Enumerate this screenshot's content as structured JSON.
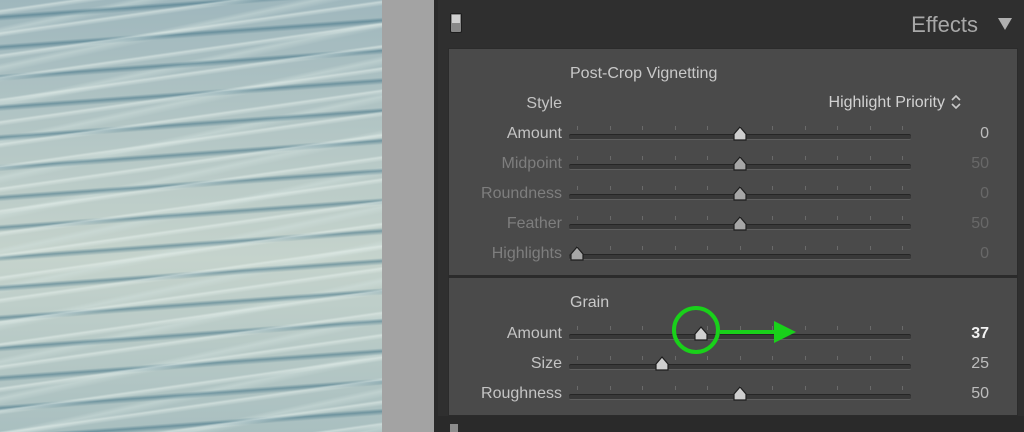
{
  "panel": {
    "title": "Effects"
  },
  "vignetting": {
    "title": "Post-Crop Vignetting",
    "style_label": "Style",
    "style_value": "Highlight Priority",
    "sliders": [
      {
        "label": "Amount",
        "value": "0",
        "position": 0.5,
        "enabled": true
      },
      {
        "label": "Midpoint",
        "value": "50",
        "position": 0.5,
        "enabled": false
      },
      {
        "label": "Roundness",
        "value": "0",
        "position": 0.5,
        "enabled": false
      },
      {
        "label": "Feather",
        "value": "50",
        "position": 0.5,
        "enabled": false
      },
      {
        "label": "Highlights",
        "value": "0",
        "position": 0.0,
        "enabled": false
      }
    ]
  },
  "grain": {
    "title": "Grain",
    "sliders": [
      {
        "label": "Amount",
        "value": "37",
        "position": 0.38,
        "enabled": true,
        "highlight": true
      },
      {
        "label": "Size",
        "value": "25",
        "position": 0.26,
        "enabled": true
      },
      {
        "label": "Roughness",
        "value": "50",
        "position": 0.5,
        "enabled": true
      }
    ]
  },
  "annotation": {
    "color": "#19d11a"
  }
}
